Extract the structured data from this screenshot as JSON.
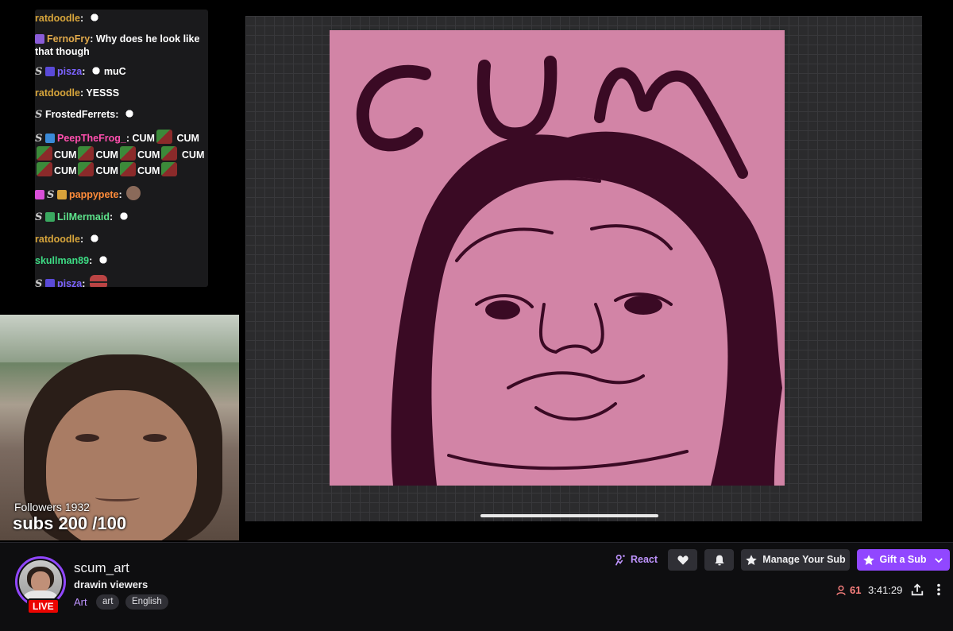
{
  "chat": {
    "messages": [
      {
        "user": "ratdoodle",
        "color": "#d7a53b",
        "sep": ":",
        "text": ""
      },
      {
        "user": "FernoFry",
        "color": "#e0a94b",
        "sep": ":",
        "text": "Why does he look like that though"
      },
      {
        "user": "pisza",
        "color": "#7c63ff",
        "sep": ":",
        "text": "muC"
      },
      {
        "user": "ratdoodle",
        "color": "#d7a53b",
        "sep": ":",
        "text": "YESSS"
      },
      {
        "user": "FrostedFerrets",
        "color": "#ffffff",
        "sep": ":",
        "text": ""
      },
      {
        "user": "PeepTheFrog_",
        "color": "#ff4fae",
        "sep": ":",
        "text": "CUM"
      },
      {
        "user": "pappypete",
        "color": "#ff8c3a",
        "sep": ":",
        "text": ""
      },
      {
        "user": "LilMermaid",
        "color": "#5de38b",
        "sep": ":",
        "text": ""
      },
      {
        "user": "ratdoodle",
        "color": "#d7a53b",
        "sep": ":",
        "text": ""
      },
      {
        "user": "skullman89",
        "color": "#3ddc84",
        "sep": ":",
        "text": ""
      },
      {
        "user": "pisza",
        "color": "#7c63ff",
        "sep": ":",
        "text": ""
      }
    ],
    "spam_word": "CUM"
  },
  "webcam": {
    "followers_text": "Followers 1932",
    "subs_text": "subs 200 /100"
  },
  "artwork": {
    "title_text": "CUM",
    "bg_color": "#d284a6",
    "ink_color": "#3a0a24"
  },
  "channel": {
    "name": "scum_art",
    "title": "drawin viewers",
    "category": "Art",
    "tags": [
      "art",
      "English"
    ],
    "live_label": "LIVE"
  },
  "actions": {
    "react_label": "React",
    "manage_sub_label": "Manage Your Sub",
    "gift_sub_label": "Gift a Sub"
  },
  "stats": {
    "viewer_count": "61",
    "uptime": "3:41:29"
  },
  "icons": {
    "react": "react-icon",
    "heart": "heart-icon",
    "bell": "bell-icon",
    "star": "star-icon",
    "chevron": "chevron-down-icon",
    "viewers": "person-icon",
    "share": "share-icon",
    "more": "more-vertical-icon"
  },
  "colors": {
    "accent": "#9147ff",
    "live": "#eb0400",
    "viewer_red": "#ff8280"
  }
}
